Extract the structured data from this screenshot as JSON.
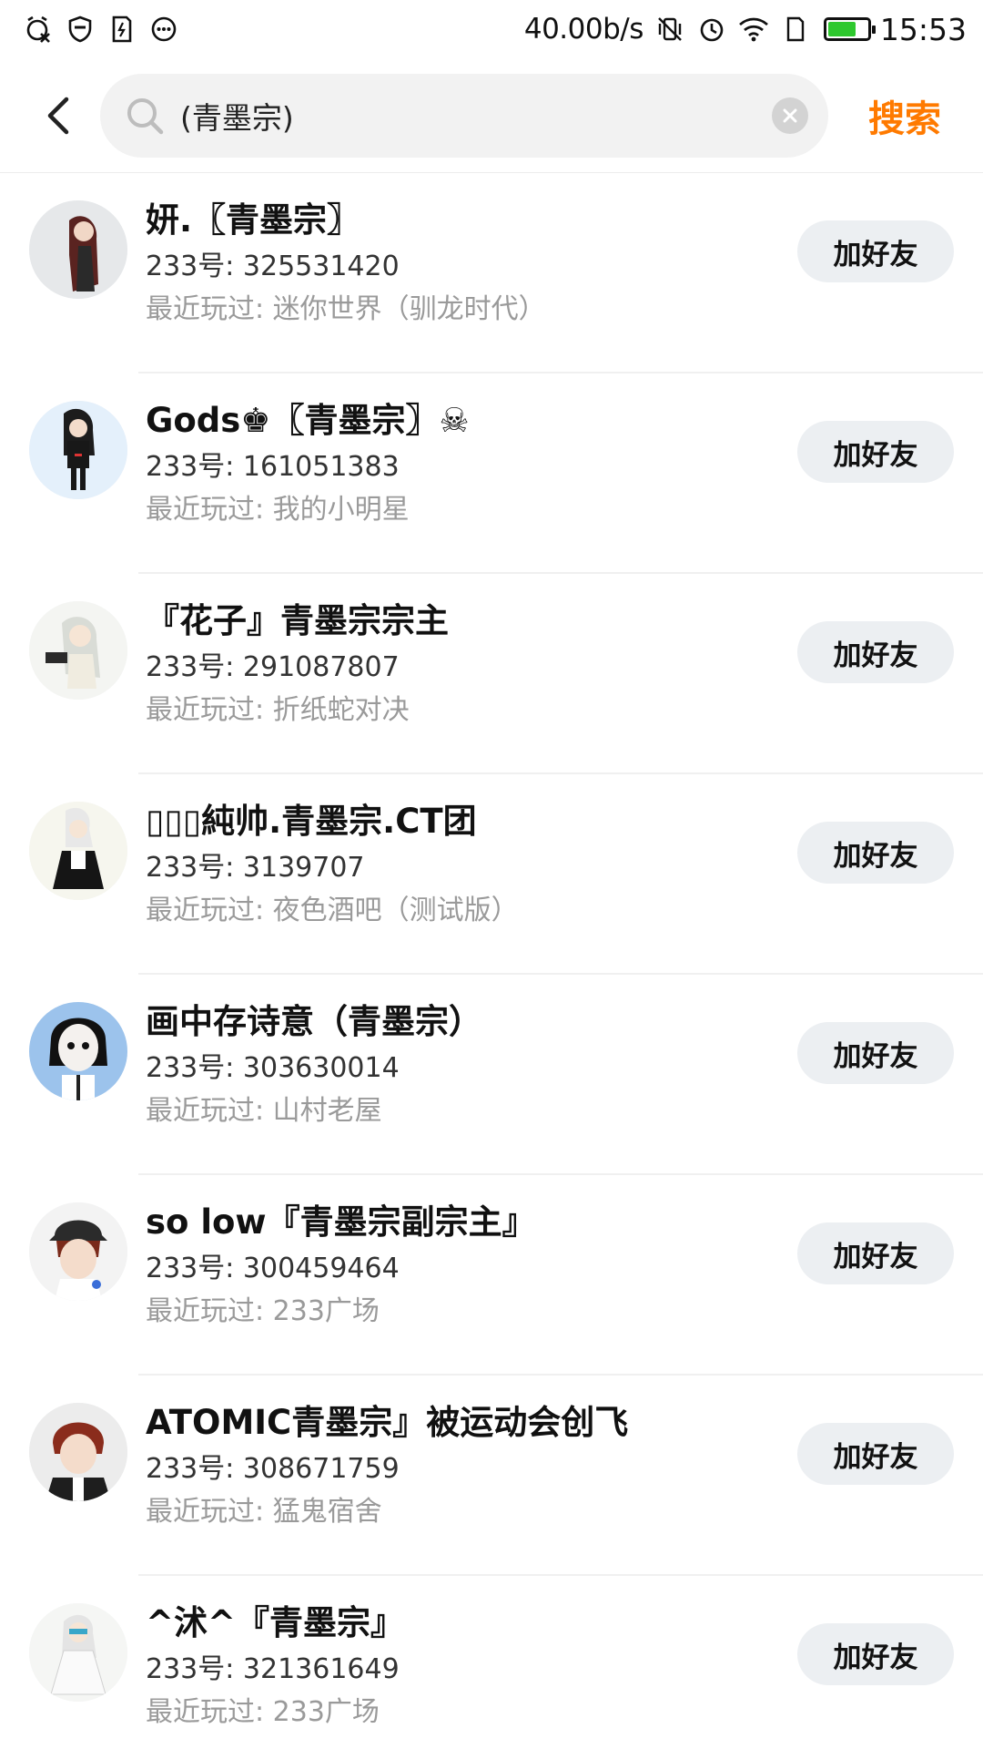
{
  "status_bar": {
    "net_speed": "40.00b/s",
    "time": "15:53",
    "battery_level": 0.72,
    "battery_color": "#2ec82e",
    "left_icons": [
      "alarm-off-icon",
      "shield-icon",
      "sd-card-icon",
      "more-dots-icon"
    ],
    "right_icons": [
      "vibrate-off-icon",
      "alarm-clock-icon",
      "wifi-icon",
      "sim-icon",
      "battery-icon"
    ]
  },
  "search": {
    "query": "(青墨宗)",
    "submit_label": "搜索",
    "accent_color": "#ff7a00"
  },
  "results": [
    {
      "name": "妍.〖青墨宗〗",
      "uid": "233号: 325531420",
      "recent": "最近玩过: 迷你世界（驯龙时代）",
      "add_label": "加好友"
    },
    {
      "name": "Gods♚〖青墨宗〗☠",
      "uid": "233号: 161051383",
      "recent": "最近玩过: 我的小明星",
      "add_label": "加好友"
    },
    {
      "name": "『花子』青墨宗宗主",
      "uid": "233号: 291087807",
      "recent": "最近玩过: 折纸蛇对决",
      "add_label": "加好友"
    },
    {
      "name": "▯▯▯純帅.青墨宗.CT团",
      "uid": "233号: 3139707",
      "recent": "最近玩过: 夜色酒吧（测试版）",
      "add_label": "加好友"
    },
    {
      "name": "画中存诗意（青墨宗）",
      "uid": "233号: 303630014",
      "recent": "最近玩过: 山村老屋",
      "add_label": "加好友"
    },
    {
      "name": "so low『青墨宗副宗主』",
      "uid": "233号: 300459464",
      "recent": "最近玩过: 233广场",
      "add_label": "加好友"
    },
    {
      "name": "ATOMIC青墨宗』被运动会创飞",
      "uid": "233号: 308671759",
      "recent": "最近玩过: 猛鬼宿舍",
      "add_label": "加好友"
    },
    {
      "name": "^沭^『青墨宗』",
      "uid": "233号: 321361649",
      "recent": "最近玩过: 233广场",
      "add_label": "加好友"
    }
  ]
}
